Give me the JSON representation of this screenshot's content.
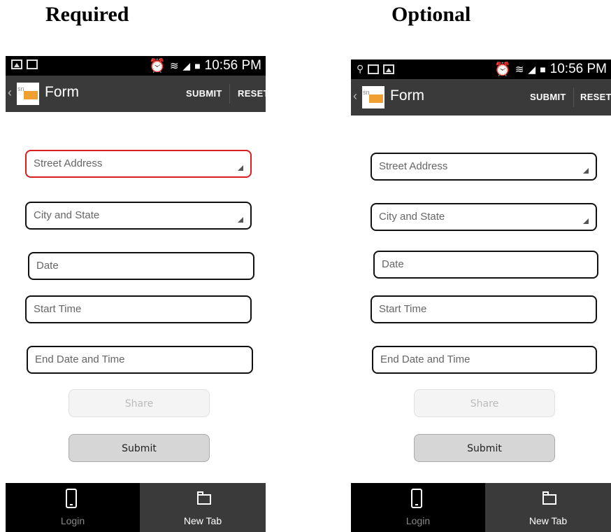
{
  "captions": {
    "left": "Required",
    "right": "Optional"
  },
  "status_bar": {
    "time": "10:56 PM"
  },
  "action_bar": {
    "back": "‹",
    "logo_text": "sn",
    "title": "Form",
    "submit": "SUBMIT",
    "reset": "RESET"
  },
  "fields": [
    {
      "label": "Street Address"
    },
    {
      "label": "City and State"
    },
    {
      "label": "Date"
    },
    {
      "label": "Start Time"
    },
    {
      "label": "End Date and Time"
    }
  ],
  "buttons": {
    "share": "Share",
    "submit": "Submit"
  },
  "tabs": {
    "login": "Login",
    "new_tab": "New Tab"
  },
  "icons": {
    "status_left": [
      "image-icon",
      "message-icon"
    ],
    "status_right": [
      "alarm-icon",
      "wifi-icon",
      "signal-icon",
      "battery-icon"
    ],
    "status_left_optional": [
      "location-icon",
      "message-icon",
      "image-icon"
    ],
    "tabs": [
      "phone-icon",
      "folder-icon"
    ]
  },
  "colors": {
    "required_border": "#d81e1e",
    "action_bar": "#3a3a3a",
    "status_bar": "#000000"
  }
}
